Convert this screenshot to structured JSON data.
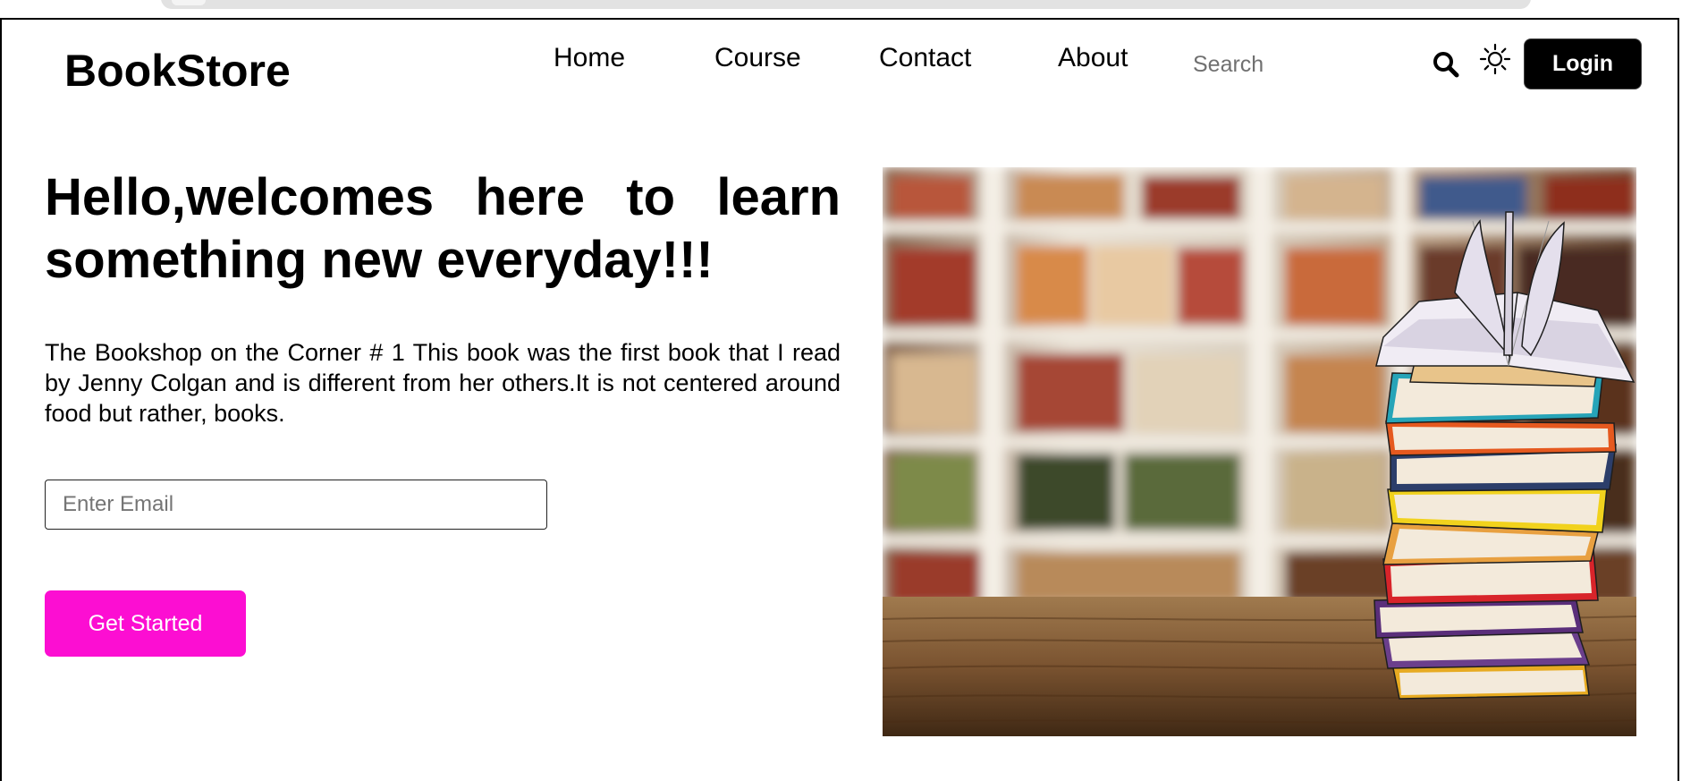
{
  "header": {
    "logo": "BookStore",
    "nav": [
      {
        "label": "Home"
      },
      {
        "label": "Course"
      },
      {
        "label": "Contact"
      },
      {
        "label": "About"
      }
    ],
    "search": {
      "placeholder": "Search",
      "value": ""
    },
    "search_icon": "search-icon",
    "theme_icon": "sun-icon",
    "login_label": "Login"
  },
  "hero": {
    "title": "Hello,welcomes here to learn something new everyday!!!",
    "description": "The Bookshop on the Corner # 1 This book was the first book that I read by Jenny Colgan and is different from her others.It is not centered around food but rather, books.",
    "email": {
      "placeholder": "Enter Email",
      "value": ""
    },
    "cta_label": "Get Started",
    "image": "stack-of-books-on-wooden-table-in-library"
  },
  "colors": {
    "accent": "#fc0ed2",
    "login_bg": "#000000",
    "text": "#000000"
  }
}
